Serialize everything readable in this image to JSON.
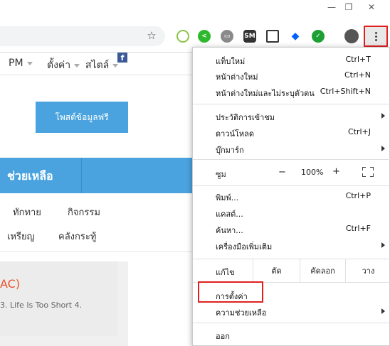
{
  "window": {
    "minimize": "—",
    "restore": "❐",
    "close": "✕"
  },
  "toolbar": {
    "extensions": [
      "nitro-ext-icon",
      "share-ext-icon",
      "line-ext-icon",
      "sm-ext-icon",
      "capture-ext-icon",
      "dropbox-ext-icon",
      "check-ext-icon",
      "avatar-icon"
    ],
    "sm_label": "SM"
  },
  "page": {
    "nav": [
      "PM",
      "ตั้งค่า",
      "สไตล์"
    ],
    "fb_icon": "f",
    "post_button": "โพสต์ข้อมูลฟรี",
    "help_title": "ช่วยเหลือ",
    "sub_row1": [
      "ทักทาย",
      "กิจกรรม"
    ],
    "sub_row2": [
      "เหรียญ",
      "คลังกระทู้"
    ],
    "card_title": "AC)",
    "card_text": "3. Life Is Too Short 4."
  },
  "menu": {
    "new_tab": "แท็บใหม่",
    "new_tab_sc": "Ctrl+T",
    "new_window": "หน้าต่างใหม่",
    "new_window_sc": "Ctrl+N",
    "incognito": "หน้าต่างใหม่และไม่ระบุตัวตน",
    "incognito_sc": "Ctrl+Shift+N",
    "history": "ประวัติการเข้าชม",
    "downloads": "ดาวน์โหลด",
    "downloads_sc": "Ctrl+J",
    "bookmarks": "บุ๊กมาร์ก",
    "zoom": "ซูม",
    "zoom_minus": "−",
    "zoom_value": "100%",
    "zoom_plus": "+",
    "print": "พิมพ์...",
    "print_sc": "Ctrl+P",
    "cast": "แคสต์...",
    "find": "ค้นหา...",
    "find_sc": "Ctrl+F",
    "more_tools": "เครื่องมือเพิ่มเติม",
    "edit": "แก้ไข",
    "cut": "ตัด",
    "copy": "คัดลอก",
    "paste": "วาง",
    "settings": "การตั้งค่า",
    "help": "ความช่วยเหลือ",
    "exit": "ออก"
  },
  "colors": {
    "accent_blue": "#4aa3df",
    "highlight_red": "#e02020",
    "card_title": "#e8542c"
  }
}
